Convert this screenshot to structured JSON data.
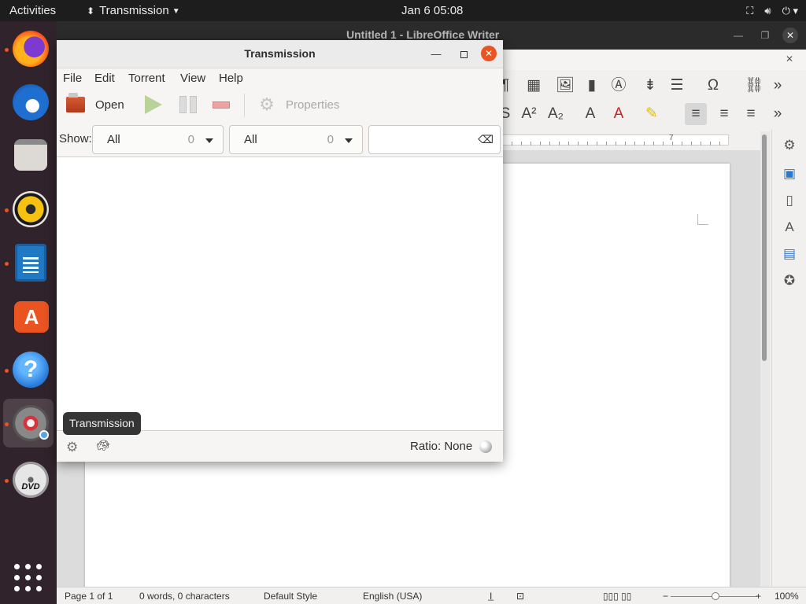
{
  "topbar": {
    "activities": "Activities",
    "app_name": "Transmission",
    "clock": "Jan 6  05:08",
    "tray_icons": [
      "network-icon",
      "volume-icon",
      "power-icon"
    ]
  },
  "dock": {
    "items": [
      "Firefox",
      "Thunderbird",
      "Files",
      "Rhythmbox",
      "LibreOffice Writer",
      "Ubuntu Software",
      "Help",
      "Transmission",
      "DVD"
    ],
    "dvd_label": "DVD",
    "tooltip": "Transmission"
  },
  "writer": {
    "title": "Untitled 1 - LibreOffice Writer",
    "ruler_mark": "7",
    "status": {
      "page": "Page 1 of 1",
      "words": "0 words, 0 characters",
      "style": "Default Style",
      "language": "English (USA)",
      "zoom": "100%",
      "zoom_level": 1.0
    }
  },
  "transmission": {
    "title": "Transmission",
    "menu": [
      "File",
      "Edit",
      "Torrent",
      "View",
      "Help"
    ],
    "toolbar": {
      "open_label": "Open",
      "properties_label": "Properties"
    },
    "filter": {
      "show_label": "Show:",
      "activity_value": "All",
      "activity_count": "0",
      "tracker_value": "All",
      "tracker_count": "0",
      "search_value": ""
    },
    "status": {
      "ratio": "Ratio: None"
    }
  },
  "colors": {
    "accent": "#e95420",
    "topbar": "#1d1d1d",
    "dock": "#31232b"
  }
}
